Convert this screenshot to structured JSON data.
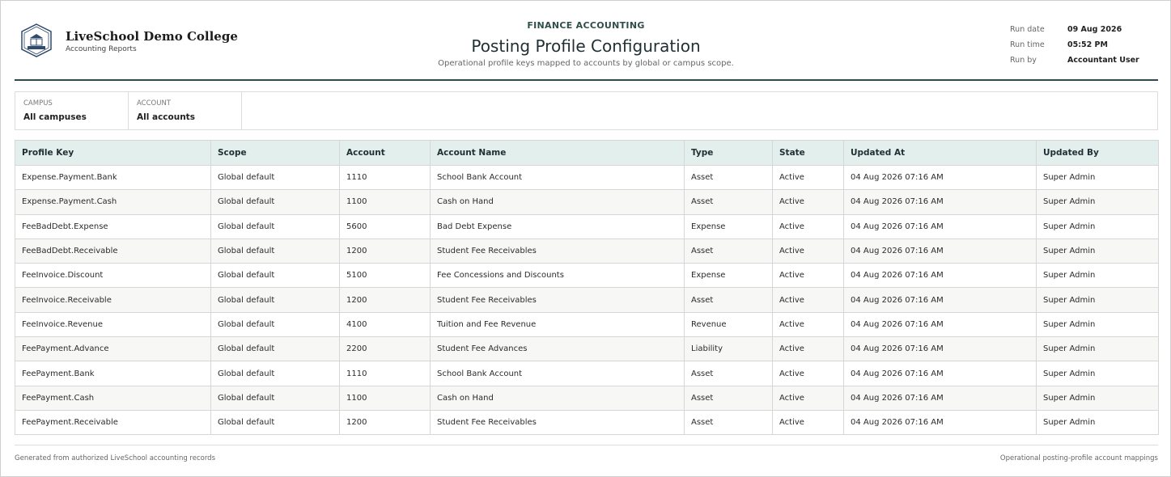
{
  "org": {
    "name": "LiveSchool Demo College",
    "subtitle": "Accounting Reports"
  },
  "report": {
    "eyebrow": "FINANCE ACCOUNTING",
    "title": "Posting Profile Configuration",
    "subtitle": "Operational profile keys mapped to accounts by global or campus scope."
  },
  "meta": {
    "run_date_label": "Run date",
    "run_date": "09 Aug 2026",
    "run_time_label": "Run time",
    "run_time": "05:52 PM",
    "run_by_label": "Run by",
    "run_by": "Accountant User"
  },
  "filters": {
    "campus_label": "CAMPUS",
    "campus_value": "All campuses",
    "account_label": "ACCOUNT",
    "account_value": "All accounts"
  },
  "table": {
    "columns": [
      "Profile Key",
      "Scope",
      "Account",
      "Account Name",
      "Type",
      "State",
      "Updated At",
      "Updated By"
    ],
    "rows": [
      [
        "Expense.Payment.Bank",
        "Global default",
        "1110",
        "School Bank Account",
        "Asset",
        "Active",
        "04 Aug 2026 07:16 AM",
        "Super Admin"
      ],
      [
        "Expense.Payment.Cash",
        "Global default",
        "1100",
        "Cash on Hand",
        "Asset",
        "Active",
        "04 Aug 2026 07:16 AM",
        "Super Admin"
      ],
      [
        "FeeBadDebt.Expense",
        "Global default",
        "5600",
        "Bad Debt Expense",
        "Expense",
        "Active",
        "04 Aug 2026 07:16 AM",
        "Super Admin"
      ],
      [
        "FeeBadDebt.Receivable",
        "Global default",
        "1200",
        "Student Fee Receivables",
        "Asset",
        "Active",
        "04 Aug 2026 07:16 AM",
        "Super Admin"
      ],
      [
        "FeeInvoice.Discount",
        "Global default",
        "5100",
        "Fee Concessions and Discounts",
        "Expense",
        "Active",
        "04 Aug 2026 07:16 AM",
        "Super Admin"
      ],
      [
        "FeeInvoice.Receivable",
        "Global default",
        "1200",
        "Student Fee Receivables",
        "Asset",
        "Active",
        "04 Aug 2026 07:16 AM",
        "Super Admin"
      ],
      [
        "FeeInvoice.Revenue",
        "Global default",
        "4100",
        "Tuition and Fee Revenue",
        "Revenue",
        "Active",
        "04 Aug 2026 07:16 AM",
        "Super Admin"
      ],
      [
        "FeePayment.Advance",
        "Global default",
        "2200",
        "Student Fee Advances",
        "Liability",
        "Active",
        "04 Aug 2026 07:16 AM",
        "Super Admin"
      ],
      [
        "FeePayment.Bank",
        "Global default",
        "1110",
        "School Bank Account",
        "Asset",
        "Active",
        "04 Aug 2026 07:16 AM",
        "Super Admin"
      ],
      [
        "FeePayment.Cash",
        "Global default",
        "1100",
        "Cash on Hand",
        "Asset",
        "Active",
        "04 Aug 2026 07:16 AM",
        "Super Admin"
      ],
      [
        "FeePayment.Receivable",
        "Global default",
        "1200",
        "Student Fee Receivables",
        "Asset",
        "Active",
        "04 Aug 2026 07:16 AM",
        "Super Admin"
      ]
    ]
  },
  "footer": {
    "left": "Generated from authorized LiveSchool accounting records",
    "right": "Operational posting-profile account mappings"
  },
  "colors": {
    "accent": "#2f4a4f",
    "header_bg": "#e3efec"
  }
}
